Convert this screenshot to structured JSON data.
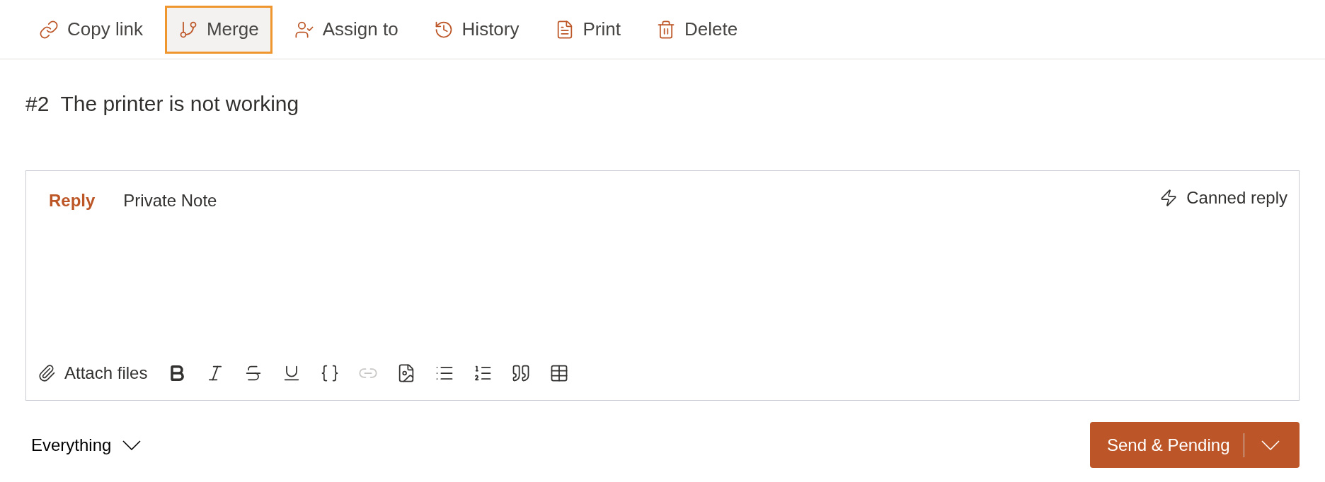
{
  "actions": [
    {
      "label": "Copy link",
      "kind": "link",
      "focused": false
    },
    {
      "label": "Merge",
      "kind": "merge",
      "focused": true
    },
    {
      "label": "Assign to",
      "kind": "assign",
      "focused": false
    },
    {
      "label": "History",
      "kind": "history",
      "focused": false
    },
    {
      "label": "Print",
      "kind": "print",
      "focused": false
    },
    {
      "label": "Delete",
      "kind": "delete",
      "focused": false
    }
  ],
  "ticket": {
    "number": "#2",
    "title": "The printer is not working"
  },
  "editor": {
    "tabs": [
      {
        "label": "Reply",
        "selected": true
      },
      {
        "label": "Private Note",
        "selected": false
      }
    ],
    "canned_reply": "Canned reply",
    "attach": "Attach files",
    "tools": [
      {
        "kind": "bold",
        "disabled": false
      },
      {
        "kind": "italic",
        "disabled": false
      },
      {
        "kind": "strikethrough",
        "disabled": false
      },
      {
        "kind": "underline",
        "disabled": false
      },
      {
        "kind": "code",
        "disabled": false
      },
      {
        "kind": "link",
        "disabled": true
      },
      {
        "kind": "image",
        "disabled": false
      },
      {
        "kind": "bullets",
        "disabled": false
      },
      {
        "kind": "numbers",
        "disabled": false
      },
      {
        "kind": "quote",
        "disabled": false
      },
      {
        "kind": "table",
        "disabled": false
      }
    ]
  },
  "filter": {
    "value": "Everything"
  },
  "send_button": {
    "label": "Send & Pending"
  }
}
